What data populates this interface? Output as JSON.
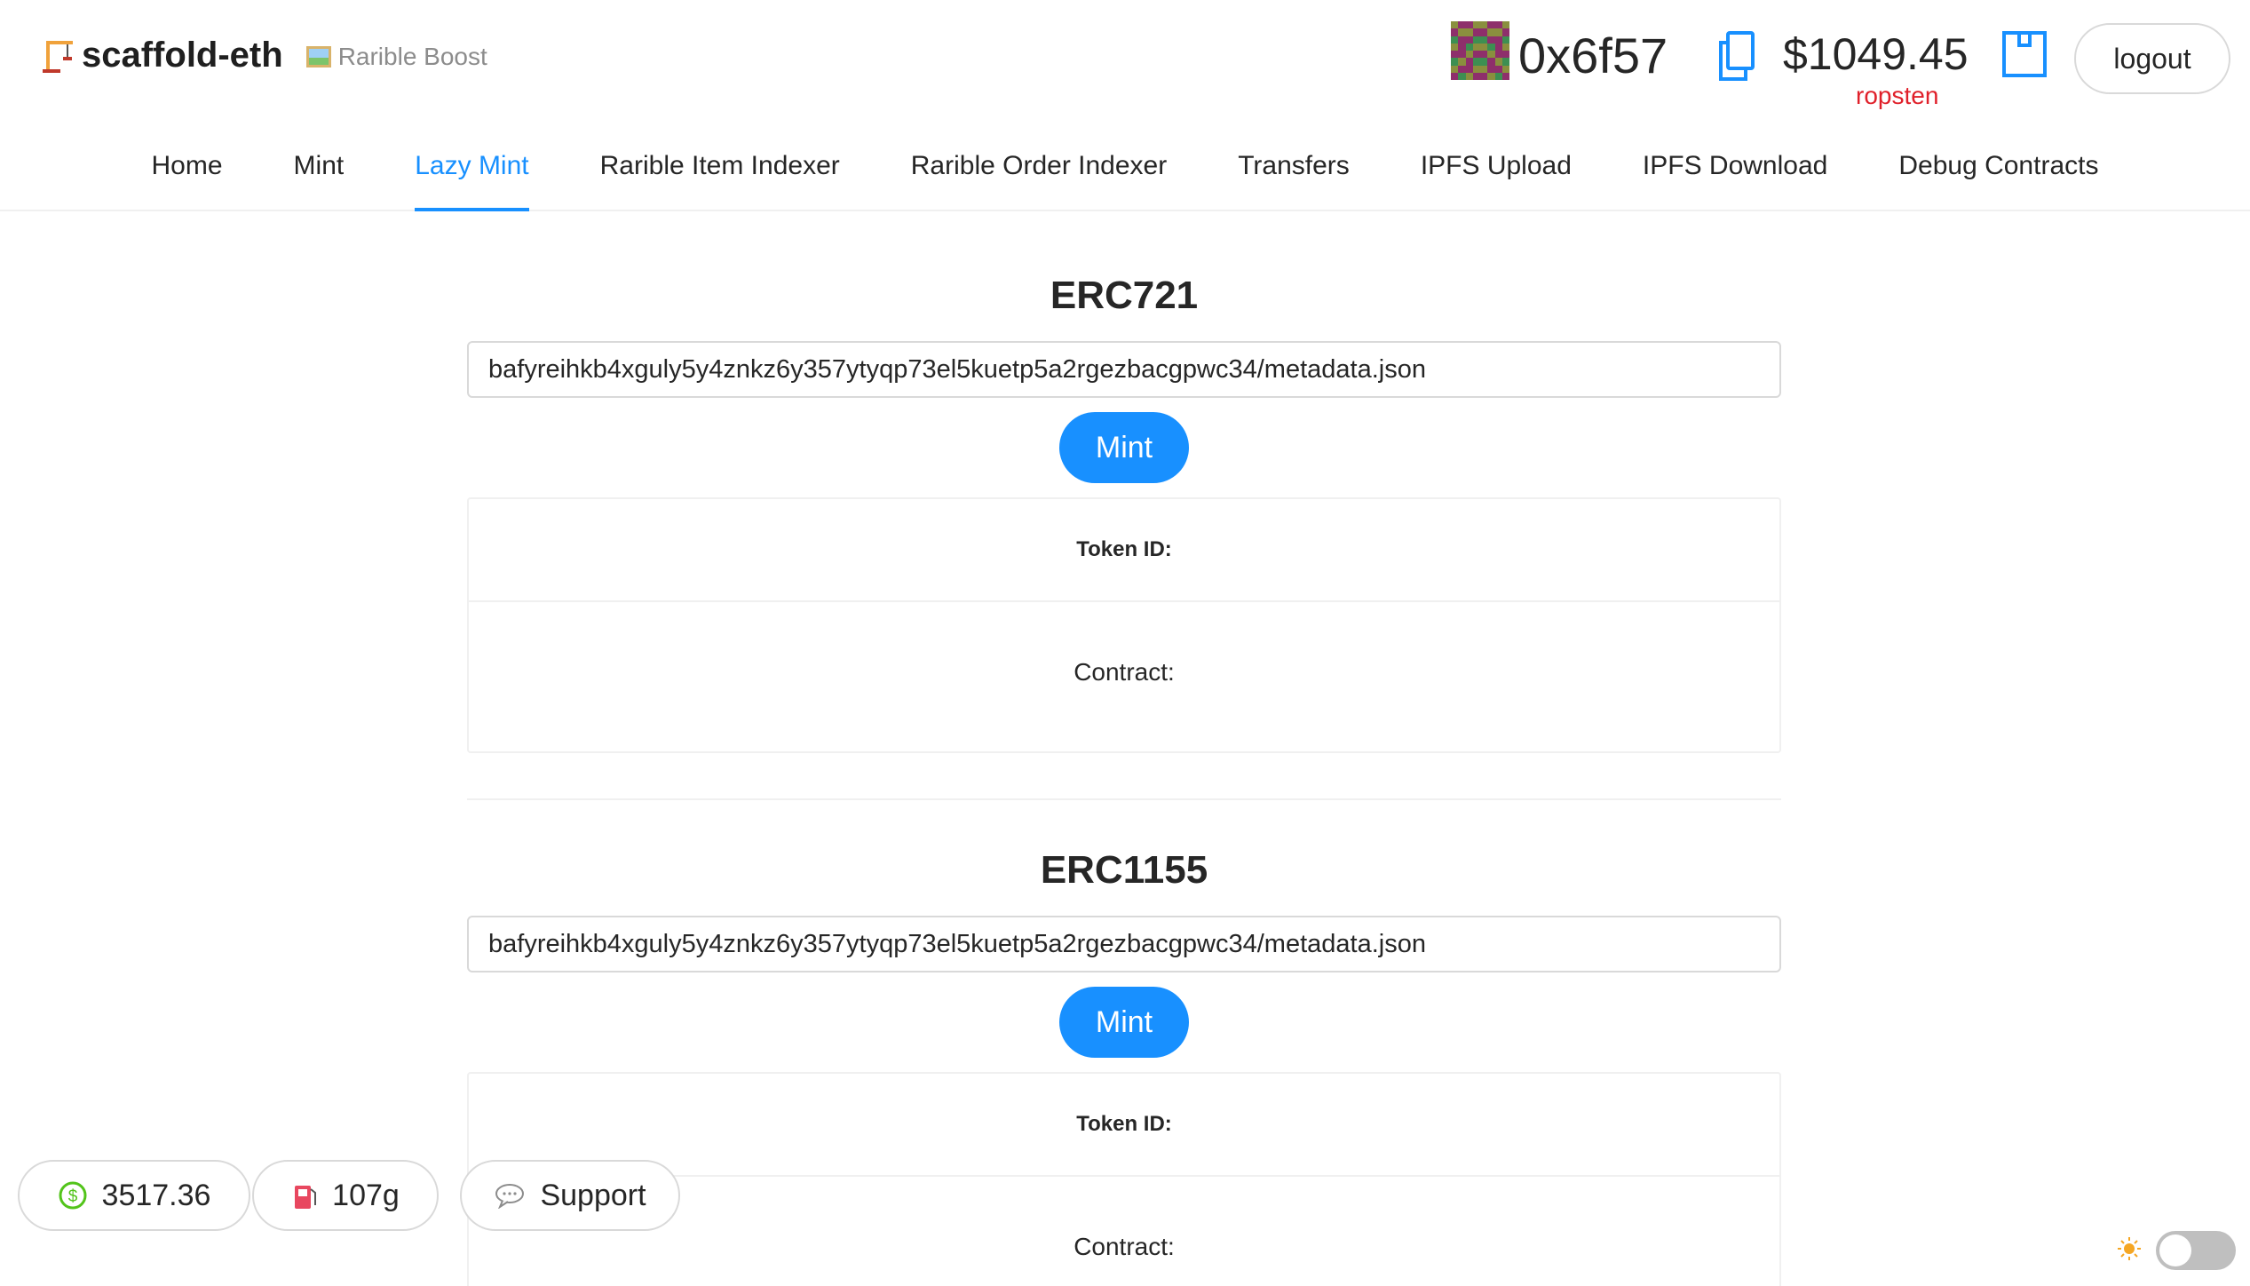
{
  "header": {
    "brand_title": "scaffold-eth",
    "brand_subtitle": "Rarible Boost",
    "address": "0x6f57",
    "balance": "$1049.45",
    "network": "ropsten",
    "network_color": "#e0202a",
    "logout_label": "logout",
    "icons": {
      "brand": "crane-icon",
      "subtitle": "framed-picture-icon",
      "copy": "copy-icon",
      "wallet": "wallet-icon"
    }
  },
  "nav": {
    "items": [
      {
        "label": "Home",
        "active": false
      },
      {
        "label": "Mint",
        "active": false
      },
      {
        "label": "Lazy Mint",
        "active": true
      },
      {
        "label": "Rarible Item Indexer",
        "active": false
      },
      {
        "label": "Rarible Order Indexer",
        "active": false
      },
      {
        "label": "Transfers",
        "active": false
      },
      {
        "label": "IPFS Upload",
        "active": false
      },
      {
        "label": "IPFS Download",
        "active": false
      },
      {
        "label": "Debug Contracts",
        "active": false
      }
    ],
    "accent_color": "#1890ff"
  },
  "erc721": {
    "title": "ERC721",
    "uri_value": "bafyreihkb4xguly5y4znkz6y357ytyqp73el5kuetp5a2rgezbacgpwc34/metadata.json",
    "mint_label": "Mint",
    "token_id_label": "Token ID:",
    "contract_label": "Contract:"
  },
  "erc1155": {
    "title": "ERC1155",
    "uri_value": "bafyreihkb4xguly5y4znkz6y357ytyqp73el5kuetp5a2rgezbacgpwc34/metadata.json",
    "mint_label": "Mint",
    "token_id_label": "Token ID:",
    "contract_label": "Contract:"
  },
  "footer": {
    "eth_price": "3517.36",
    "gas_price": "107g",
    "support_label": "Support",
    "icons": {
      "price": "dollar-circle-icon",
      "gas": "fuel-pump-icon",
      "support": "speech-bubble-icon",
      "theme": "sun-icon"
    },
    "theme_toggle_on": false
  }
}
